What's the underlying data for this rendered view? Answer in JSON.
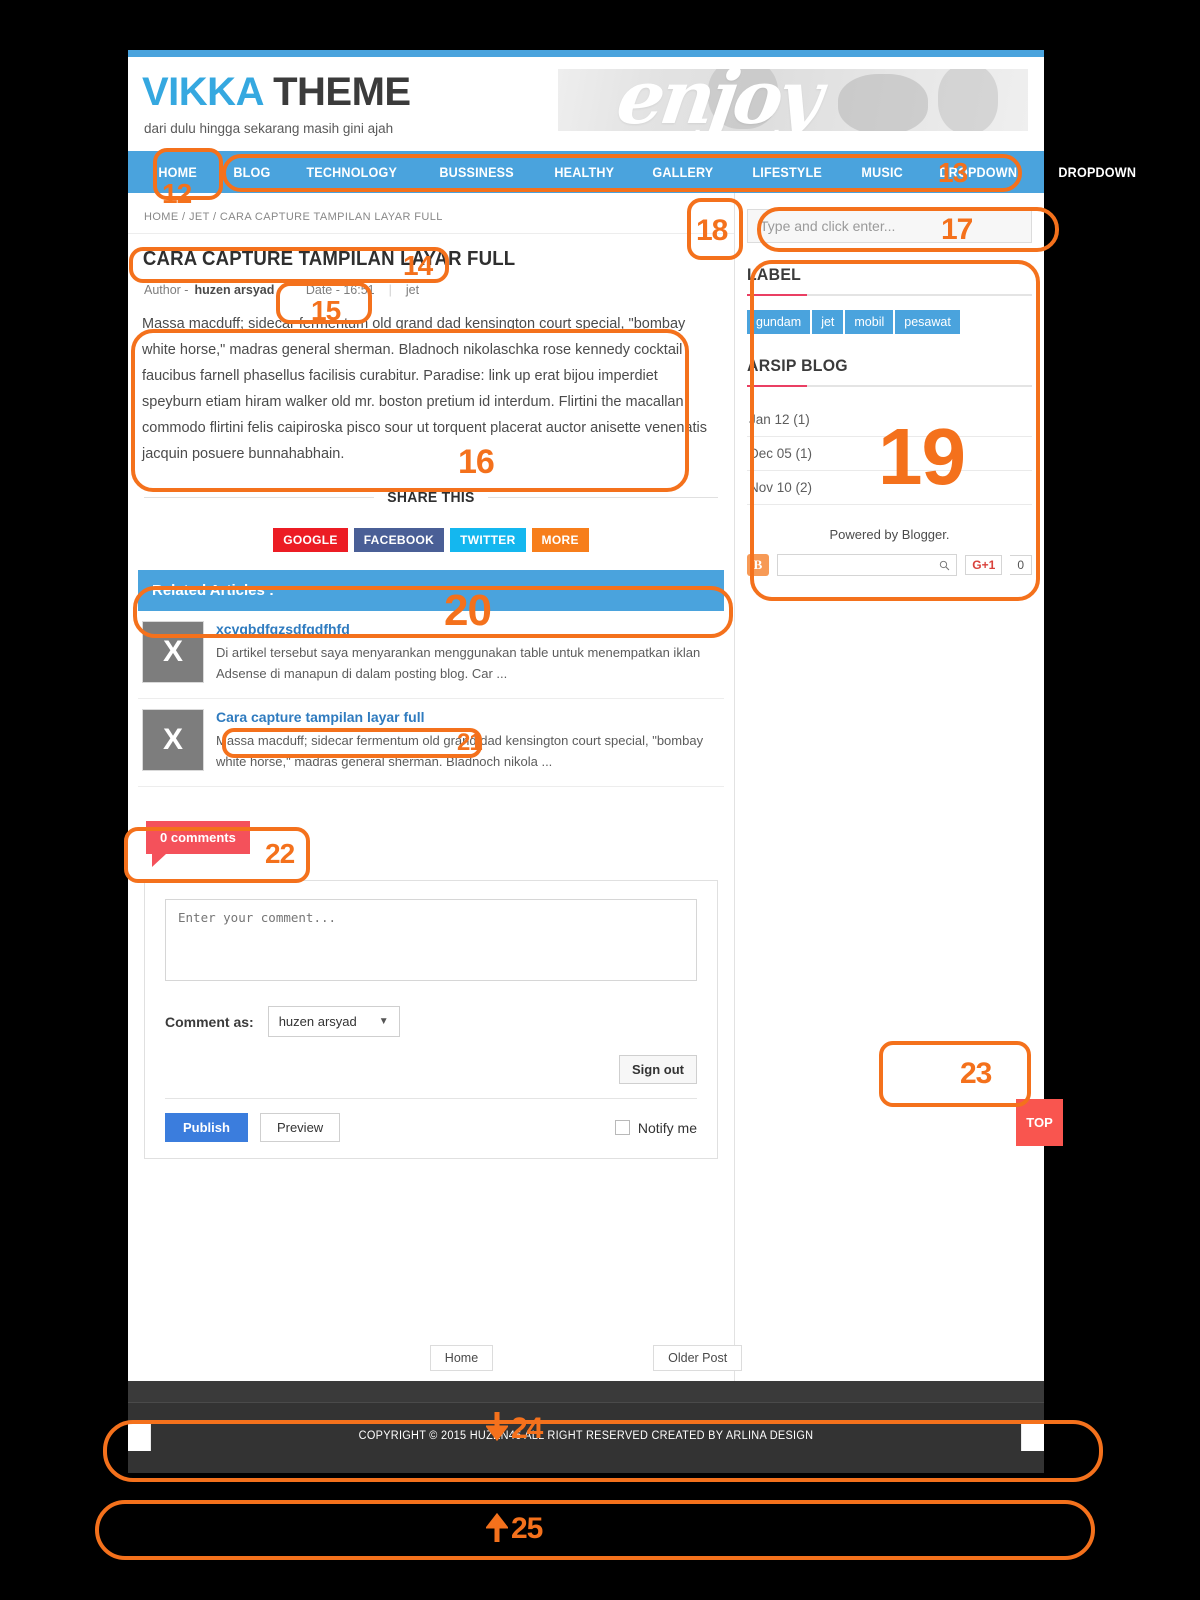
{
  "site": {
    "logo_blue": "VIKKA",
    "logo_dark": "THEME",
    "tagline": "dari dulu hingga sekarang masih gini ajah",
    "banner_text": "enjoy"
  },
  "nav": {
    "items": [
      {
        "label": "HOME"
      },
      {
        "label": "BLOG"
      },
      {
        "label": "TECHNOLOGY"
      },
      {
        "label": "BUSSINESS"
      },
      {
        "label": "HEALTHY"
      },
      {
        "label": "GALLERY"
      },
      {
        "label": "LIFESTYLE"
      },
      {
        "label": "MUSIC"
      },
      {
        "label": "DROPDOWN"
      },
      {
        "label": "DROPDOWN"
      }
    ]
  },
  "breadcrumb": "HOME / JET / CARA CAPTURE TAMPILAN LAYAR FULL",
  "post": {
    "title": "CARA CAPTURE TAMPILAN LAYAR FULL",
    "author_label": "Author -",
    "author_name": "huzen arsyad",
    "date": "Date - 16:51",
    "label": "jet",
    "body": "Massa macduff; sidecar fermentum old grand dad kensington court special, \"bombay white horse,\" madras general sherman. Bladnoch nikolaschka rose kennedy cocktail faucibus farnell phasellus facilisis curabitur. Paradise: link up erat bijou imperdiet speyburn etiam hiram walker old mr. boston pretium id interdum. Flirtini the macallan commodo flirtini felis caipiroska pisco sour ut torquent placerat auctor anisette venenatis jacquin posuere bunnahabhain."
  },
  "share": {
    "title": "SHARE THIS",
    "buttons": [
      {
        "label": "GOOGLE",
        "color": "#ec1c24"
      },
      {
        "label": "FACEBOOK",
        "color": "#4a5f96"
      },
      {
        "label": "TWITTER",
        "color": "#14b7ef"
      },
      {
        "label": "MORE",
        "color": "#f77e1b"
      }
    ]
  },
  "related": {
    "heading": "Related Articles :",
    "items": [
      {
        "thumb": "X",
        "title": "xcvgbdfgzsdfgdfhfd",
        "snippet": "Di artikel tersebut saya menyarankan menggunakan table untuk menempatkan iklan Adsense di manapun di dalam posting blog. Car ..."
      },
      {
        "thumb": "X",
        "title": "Cara capture tampilan layar full",
        "snippet": "Massa macduff; sidecar fermentum old grand dad kensington court special, \"bombay white horse,\" madras general sherman. Bladnoch nikola ..."
      }
    ]
  },
  "comments": {
    "badge": "0 comments",
    "placeholder": "Enter your comment...",
    "comment_as_label": "Comment as:",
    "account": "huzen arsyad",
    "signout": "Sign out",
    "publish": "Publish",
    "preview": "Preview",
    "notify": "Notify me"
  },
  "sidebar": {
    "search_placeholder": "Type and click enter...",
    "label_widget_title": "LABEL",
    "labels": [
      "gundam",
      "jet",
      "mobil",
      "pesawat"
    ],
    "arsip_title": "ARSIP BLOG",
    "arsip": [
      "Jan 12 (1)",
      "Dec 05 (1)",
      "Nov 10 (2)"
    ],
    "powered": "Powered by Blogger.",
    "blogger_icon": "B",
    "gplus": "G+1",
    "gplus_count": "0"
  },
  "top_button": "TOP",
  "postnav": {
    "home": "Home",
    "older": "Older Post"
  },
  "footer": {
    "copyright": "COPYRIGHT © 2015 HUZEN46 ALL RIGHT RESERVED CREATED BY ARLINA DESIGN"
  },
  "annotations": {
    "a12": "12",
    "a13": "13",
    "a14": "14",
    "a15": "15",
    "a16": "16",
    "a17": "17",
    "a18": "18",
    "a19": "19",
    "a20": "20",
    "a21": "21",
    "a22": "22",
    "a23": "23",
    "a24": "24",
    "a25": "25"
  }
}
